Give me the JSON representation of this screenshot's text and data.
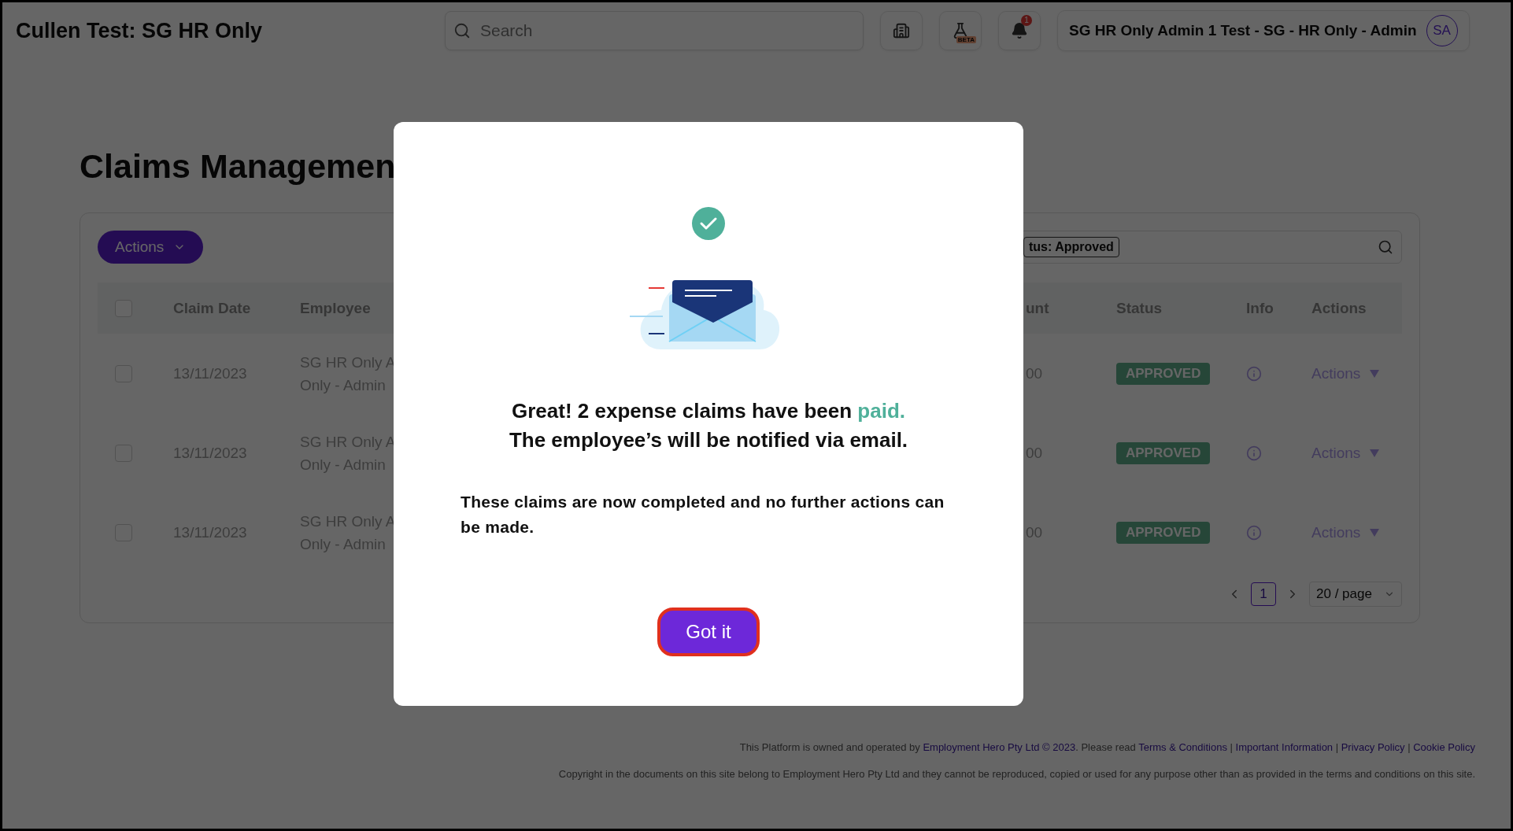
{
  "header": {
    "title": "Cullen Test: SG HR Only",
    "search": {
      "placeholder": "Search"
    },
    "beta_label": "BETA",
    "notifications": {
      "count": "1"
    },
    "user": {
      "name": "SG HR Only Admin 1 Test - SG - HR Only - Admin",
      "initials": "SA"
    }
  },
  "page": {
    "title": "Claims Managemen",
    "actions_button": "Actions",
    "filter_tag": "tus: Approved",
    "table": {
      "select_all_checked": false,
      "columns": [
        "Claim Date",
        "Employee",
        "unt",
        "Status",
        "Info",
        "Actions"
      ],
      "rows": [
        {
          "checked": false,
          "date": "13/11/2023",
          "employee": [
            "SG HR Only A",
            "Only - Admin"
          ],
          "amount": "00",
          "status": "APPROVED",
          "action": "Actions"
        },
        {
          "checked": false,
          "date": "13/11/2023",
          "employee": [
            "SG HR Only A",
            "Only - Admin"
          ],
          "amount": "00",
          "status": "APPROVED",
          "action": "Actions"
        },
        {
          "checked": false,
          "date": "13/11/2023",
          "employee": [
            "SG HR Only A",
            "Only - Admin"
          ],
          "amount": "00",
          "status": "APPROVED",
          "action": "Actions"
        }
      ]
    },
    "pagination": {
      "pages": [
        {
          "label": "1",
          "selected": true
        }
      ],
      "page_size": "20 / page"
    }
  },
  "modal": {
    "heading": {
      "text": "Great! 2 expense claims have been",
      "highlight": "paid."
    },
    "subheading": "The employee’s will be notified via email.",
    "body": "These claims are now completed and no further actions can be made.",
    "button": "Got it",
    "button_focused": true
  },
  "footer": {
    "ownership": [
      {
        "kind": "text",
        "text": "This Platform is owned and operated by "
      },
      {
        "kind": "link",
        "text": "Employment Hero Pty Ltd © 2023"
      },
      {
        "kind": "text",
        "text": ". Please read "
      },
      {
        "kind": "link",
        "text": "Terms & Conditions"
      },
      {
        "kind": "text",
        "text": " | "
      },
      {
        "kind": "link",
        "text": "Important Information"
      },
      {
        "kind": "text",
        "text": " | "
      },
      {
        "kind": "link",
        "text": "Privacy Policy"
      },
      {
        "kind": "text",
        "text": " | "
      },
      {
        "kind": "link",
        "text": "Cookie Policy"
      }
    ],
    "copyright": "Copyright in the documents on this site belong to Employment Hero Pty Ltd and they cannot be reproduced, copied or used for any purpose other than as provided in the terms and conditions on this site."
  }
}
